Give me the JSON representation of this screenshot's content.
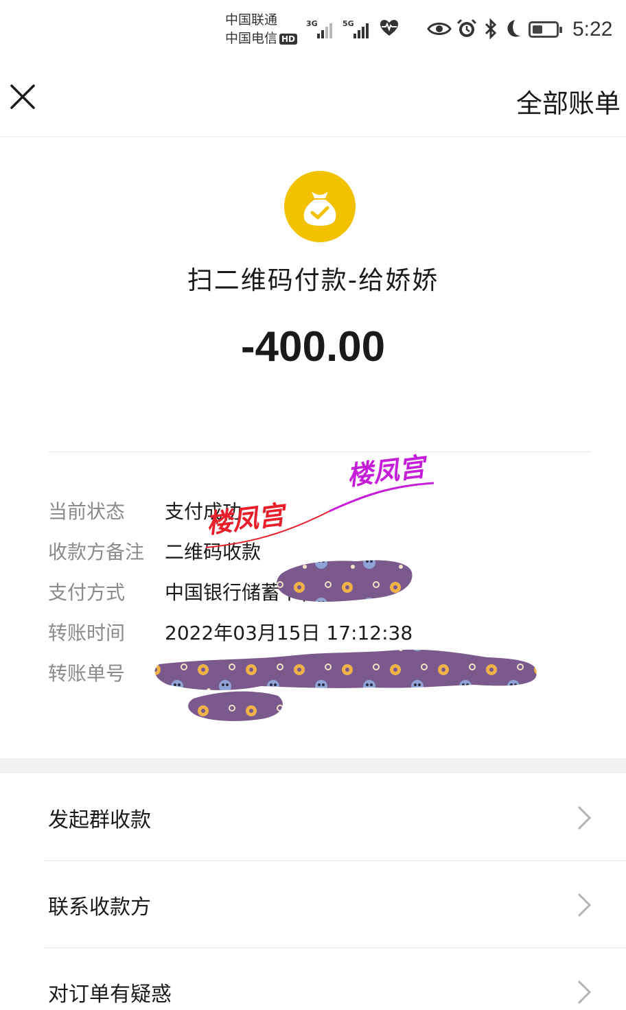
{
  "status_bar": {
    "carrier_1": "中国联通",
    "carrier_2": "中国电信",
    "hd": "HD",
    "net_1": "3G",
    "net_2": "5G",
    "time": "5:22",
    "icons": [
      "signal-icon",
      "heart-rate-icon",
      "eye-icon",
      "alarm-icon",
      "bluetooth-icon",
      "moon-icon",
      "battery-icon"
    ]
  },
  "header": {
    "close_icon": "close-icon",
    "all_bills": "全部账单"
  },
  "summary": {
    "icon": "money-bag-check-icon",
    "icon_color": "#f2c200",
    "title": "扫二维码付款-给娇娇",
    "amount": "-400.00"
  },
  "details": [
    {
      "label": "当前状态",
      "value": "支付成功"
    },
    {
      "label": "收款方备注",
      "value": "二维码收款"
    },
    {
      "label": "支付方式",
      "value": "中国银行储蓄卡("
    },
    {
      "label": "转账时间",
      "value": "2022年03月15日 17:12:38"
    },
    {
      "label": "转账单号",
      "value": ""
    }
  ],
  "watermark": {
    "text_1": "楼凤宫",
    "text_2": "楼凤宫"
  },
  "actions": [
    {
      "label": "发起群收款"
    },
    {
      "label": "联系收款方"
    },
    {
      "label": "对订单有疑惑"
    }
  ]
}
